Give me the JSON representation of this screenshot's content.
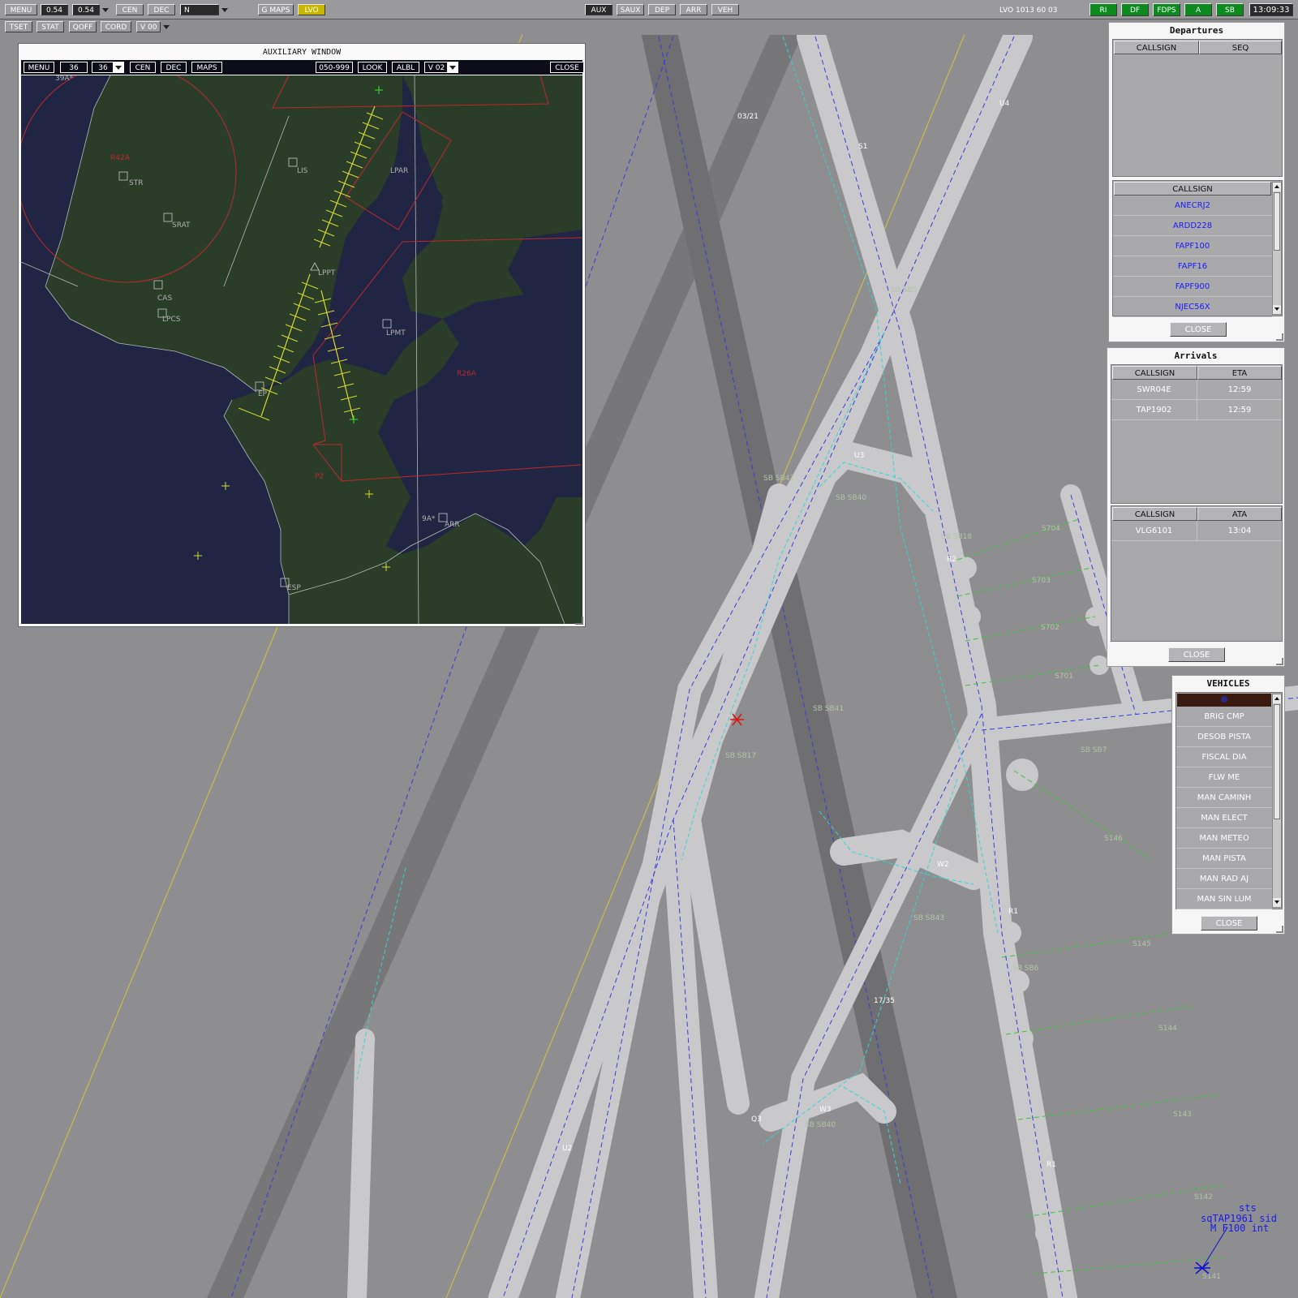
{
  "toolbar1": {
    "menu": "MENU",
    "val1": "0.54",
    "val2": "0.54",
    "cen": "CEN",
    "dec": "DEC",
    "n": "N",
    "gmaps": "G MAPS",
    "lvo": "LVO",
    "aux": "AUX",
    "saux": "SAUX",
    "dep": "DEP",
    "arr": "ARR",
    "veh": "VEH",
    "status": "LVO  1013  60  03",
    "ri": "RI",
    "df": "DF",
    "fdps": "FDPS",
    "a": "A",
    "sb": "SB",
    "time": "13:09:33"
  },
  "toolbar2": {
    "tset": "TSET",
    "stat": "STAT",
    "qoff": "QOFF",
    "cord": "CORD",
    "v00": "V 00"
  },
  "aux_window": {
    "title": "AUXILIARY WINDOW",
    "menu": "MENU",
    "range1": "36",
    "range2": "36",
    "cen": "CEN",
    "dec": "DEC",
    "maps": "MAPS",
    "alt_filter": "050-999",
    "look": "LOOK",
    "albl": "ALBL",
    "view": "V 02",
    "close": "CLOSE",
    "labels": {
      "l39ap": "39A*",
      "r42a": "R42A",
      "str": "STR",
      "lis": "LIS",
      "lpar": "LPAR",
      "srat": "SRAT",
      "lppt": "LPPT",
      "cas": "CAS",
      "lpcs": "LPCS",
      "lpmt": "LPMT",
      "r26a": "R26A",
      "esp_a": "EP",
      "p2": "P2",
      "arr_lbl": "ARR",
      "l9a": "9A*",
      "esp": "ESP"
    },
    "colors": {
      "sea": "#1f2542",
      "land": "#2a3d29",
      "restricted": "#c0282b",
      "approach": "#d8d830"
    }
  },
  "departures": {
    "title": "Departures",
    "col_callsign": "CALLSIGN",
    "col_seq": "SEQ",
    "col_callsign2": "CALLSIGN",
    "items": [
      "ANECRJ2",
      "ARDD228",
      "FAPF100",
      "FAPF16",
      "FAPF900",
      "NJEC56X"
    ],
    "close": "CLOSE"
  },
  "arrivals": {
    "title": "Arrivals",
    "col_callsign": "CALLSIGN",
    "col_eta": "ETA",
    "rows": [
      {
        "callsign": "SWR04E",
        "eta": "12:59"
      },
      {
        "callsign": "TAP1902",
        "eta": "12:59"
      }
    ],
    "col_callsign2": "CALLSIGN",
    "col_ata": "ATA",
    "landed": [
      {
        "callsign": "VLG6101",
        "ata": "13:04"
      }
    ],
    "close": "CLOSE"
  },
  "vehicles": {
    "title": "VEHICLES",
    "items": [
      "BRIG CMP",
      "DESOB PISTA",
      "FISCAL DIA",
      "FLW ME",
      "MAN CAMINH",
      "MAN ELECT",
      "MAN METEO",
      "MAN PISTA",
      "MAN RAD AJ",
      "MAN SIN LUM"
    ],
    "close": "CLOSE"
  },
  "ground_map": {
    "runway_03_21": "03/21",
    "runway_17_35": "17/35",
    "labels": {
      "u4": "U4",
      "s1": "S1",
      "u3": "U3",
      "r2": "R2",
      "w2": "W2",
      "r1": "R1",
      "w3": "W3",
      "q3": "Q3",
      "u2": "U2",
      "r1b": "R1",
      "sb_sb5": "SB SB5",
      "sb_sb42": "SB SB42",
      "sb_sb40": "SB SB40",
      "sb_sb18": "SB SB18",
      "sb_sb41": "SB SB41",
      "sb_sb17": "SB SB17",
      "sb_sb7": "SB SB7",
      "sb_sb43": "SB SB43",
      "sb_sb6": "SB SB6",
      "sb_sb40b": "SB SB40",
      "s704": "S704",
      "s703": "S703",
      "s702": "S702",
      "s701": "S701",
      "s146": "S146",
      "s145": "S145",
      "s144": "S144",
      "s143": "S143",
      "s142": "S142",
      "s141": "S141"
    },
    "track": {
      "line1": "sts",
      "line2": "sqTAP1961 sid",
      "line3": "M F100  int"
    },
    "colors": {
      "background": "#8e8e90",
      "runway": "#6f6f71",
      "taxiway": "#c9c9cb",
      "centerline": "#3a3adf",
      "route": "#30d6d6",
      "stand": "#40c040"
    }
  }
}
